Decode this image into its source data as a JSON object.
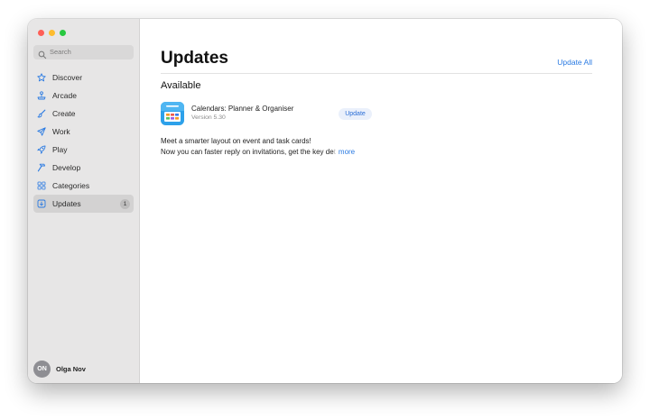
{
  "sidebar": {
    "search": {
      "placeholder": "Search"
    },
    "items": [
      {
        "label": "Discover",
        "icon": "star-icon",
        "active": false
      },
      {
        "label": "Arcade",
        "icon": "joystick-icon",
        "active": false
      },
      {
        "label": "Create",
        "icon": "paintbrush-icon",
        "active": false
      },
      {
        "label": "Work",
        "icon": "paperplane-icon",
        "active": false
      },
      {
        "label": "Play",
        "icon": "rocket-icon",
        "active": false
      },
      {
        "label": "Develop",
        "icon": "hammer-icon",
        "active": false
      },
      {
        "label": "Categories",
        "icon": "grid-icon",
        "active": false
      },
      {
        "label": "Updates",
        "icon": "download-icon",
        "active": true,
        "badge": "1"
      }
    ],
    "profile": {
      "initials": "ON",
      "name": "Olga Nov"
    }
  },
  "main": {
    "title": "Updates",
    "update_all_label": "Update All",
    "section_title": "Available",
    "apps": [
      {
        "name": "Calendars: Planner & Organiser",
        "version": "Version 5.30",
        "button_label": "Update",
        "icon": "calendar-app-icon"
      }
    ],
    "notes": {
      "line1": "Meet a smarter layout on event and task cards!",
      "line2": "Now you can faster reply on invitations, get the key de",
      "line2_faded": "t",
      "more_label": "more"
    }
  },
  "colors": {
    "accent": "#2a7ae2",
    "sidebar_bg": "#e7e6e6",
    "traffic_red": "#fe5f57",
    "traffic_yellow": "#febc2e",
    "traffic_green": "#28c840"
  }
}
